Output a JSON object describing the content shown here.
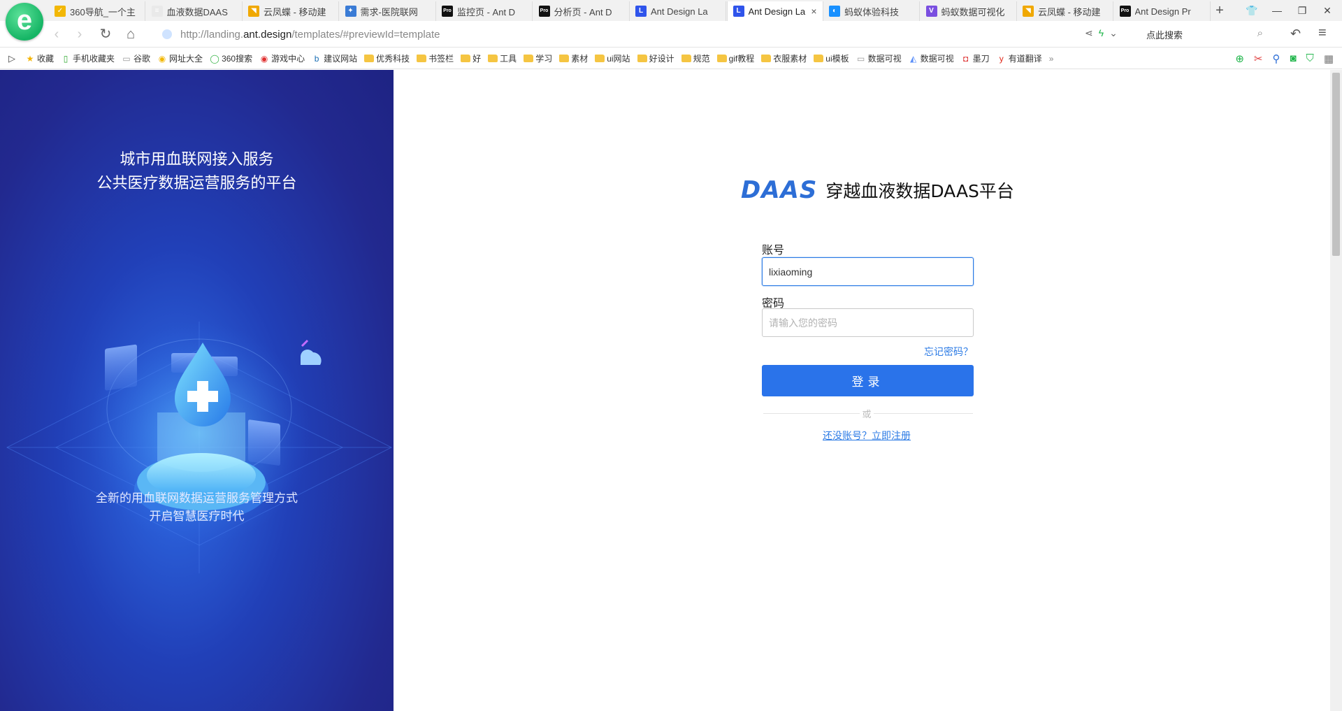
{
  "browser": {
    "tabs": [
      {
        "label": "360导航_一个主",
        "icon_color": "#f2b705",
        "icon_glyph": "✓",
        "active": false
      },
      {
        "label": "血液数据DAAS",
        "icon_color": "#e9e9e9",
        "icon_glyph": "≡",
        "active": false
      },
      {
        "label": "云凤蝶 - 移动建",
        "icon_color": "#f0a800",
        "icon_glyph": "◥",
        "active": false
      },
      {
        "label": "需求-医院联网",
        "icon_color": "#3a7bd5",
        "icon_glyph": "✦",
        "active": false
      },
      {
        "label": "监控页 - Ant D",
        "icon_color": "#111111",
        "icon_glyph": "Pro",
        "active": false
      },
      {
        "label": "分析页 - Ant D",
        "icon_color": "#111111",
        "icon_glyph": "Pro",
        "active": false
      },
      {
        "label": "Ant Design La",
        "icon_color": "#2f54eb",
        "icon_glyph": "L",
        "active": false
      },
      {
        "label": "Ant Design La",
        "icon_color": "#2f54eb",
        "icon_glyph": "L",
        "active": true
      },
      {
        "label": "蚂蚁体验科技",
        "icon_color": "#1890ff",
        "icon_glyph": "◐",
        "active": false
      },
      {
        "label": "蚂蚁数据可视化",
        "icon_color": "#7a4fe0",
        "icon_glyph": "V",
        "active": false
      },
      {
        "label": "云凤蝶 - 移动建",
        "icon_color": "#f0a800",
        "icon_glyph": "◥",
        "active": false
      },
      {
        "label": "Ant Design Pr",
        "icon_color": "#111111",
        "icon_glyph": "Pro",
        "active": false
      }
    ],
    "active_tab_close": "×",
    "new_tab": "+",
    "url_prefix": "http://landing.",
    "url_domain": "ant.design",
    "url_path": "/templates/#previewId=template",
    "search_text": "点此搜索",
    "bookmarks": [
      {
        "label": "收藏",
        "icon": "star-icon",
        "glyph": "★",
        "color": "#f5b400"
      },
      {
        "label": "手机收藏夹",
        "icon": "phone-icon",
        "glyph": "▯",
        "color": "#33aa33"
      },
      {
        "label": "谷歌",
        "icon": "page-icon",
        "glyph": "▭",
        "color": "#999999"
      },
      {
        "label": "网址大全",
        "icon": "nav-icon",
        "glyph": "◉",
        "color": "#f2b705"
      },
      {
        "label": "360搜索",
        "icon": "360-icon",
        "glyph": "◯",
        "color": "#3bb54a"
      },
      {
        "label": "游戏中心",
        "icon": "game-icon",
        "glyph": "◉",
        "color": "#e03030"
      },
      {
        "label": "建议网站",
        "icon": "bing-icon",
        "glyph": "b",
        "color": "#1a6fb5"
      },
      {
        "label": "优秀科技",
        "icon": "folder-icon",
        "glyph": "",
        "color": "#f5c542"
      },
      {
        "label": "书签栏",
        "icon": "folder-icon",
        "glyph": "",
        "color": "#f5c542"
      },
      {
        "label": "好",
        "icon": "folder-icon",
        "glyph": "",
        "color": "#f5c542"
      },
      {
        "label": "工具",
        "icon": "folder-icon",
        "glyph": "",
        "color": "#f5c542"
      },
      {
        "label": "学习",
        "icon": "folder-icon",
        "glyph": "",
        "color": "#f5c542"
      },
      {
        "label": "素材",
        "icon": "folder-icon",
        "glyph": "",
        "color": "#f5c542"
      },
      {
        "label": "ui网站",
        "icon": "folder-icon",
        "glyph": "",
        "color": "#f5c542"
      },
      {
        "label": "好设计",
        "icon": "folder-icon",
        "glyph": "",
        "color": "#f5c542"
      },
      {
        "label": "规范",
        "icon": "folder-icon",
        "glyph": "",
        "color": "#f5c542"
      },
      {
        "label": "gif教程",
        "icon": "folder-icon",
        "glyph": "",
        "color": "#f5c542"
      },
      {
        "label": "衣服素材",
        "icon": "folder-icon",
        "glyph": "",
        "color": "#f5c542"
      },
      {
        "label": "ui模板",
        "icon": "folder-icon",
        "glyph": "",
        "color": "#f5c542"
      },
      {
        "label": "数据可视",
        "icon": "page-icon",
        "glyph": "▭",
        "color": "#999999"
      },
      {
        "label": "数据可视",
        "icon": "antv-icon",
        "glyph": "◭",
        "color": "#5b8ff9"
      },
      {
        "label": "墨刀",
        "icon": "modao-icon",
        "glyph": "◘",
        "color": "#e04040"
      },
      {
        "label": "有道翻译",
        "icon": "youdao-icon",
        "glyph": "y",
        "color": "#e0281a"
      }
    ],
    "bookmarks_more": "»"
  },
  "left": {
    "title_line1": "城市用血联网接入服务",
    "title_line2": "公共医疗数据运营服务的平台",
    "footer_line1": "全新的用血联网数据运营服务管理方式",
    "footer_line2": "开启智慧医疗时代"
  },
  "login": {
    "brand_logo": "DAAS",
    "brand_name": "穿越血液数据DAAS平台",
    "account_label": "账号",
    "account_value": "lixiaoming",
    "password_label": "密码",
    "password_placeholder": "请输入您的密码",
    "forgot_label": "忘记密码？",
    "submit_label": "登录",
    "divider_text": "或",
    "register_label": "还没账号？立即注册"
  },
  "colors": {
    "primary": "#2a73ea",
    "panel_dark": "#22298f",
    "panel_light": "#2f6ee8"
  }
}
